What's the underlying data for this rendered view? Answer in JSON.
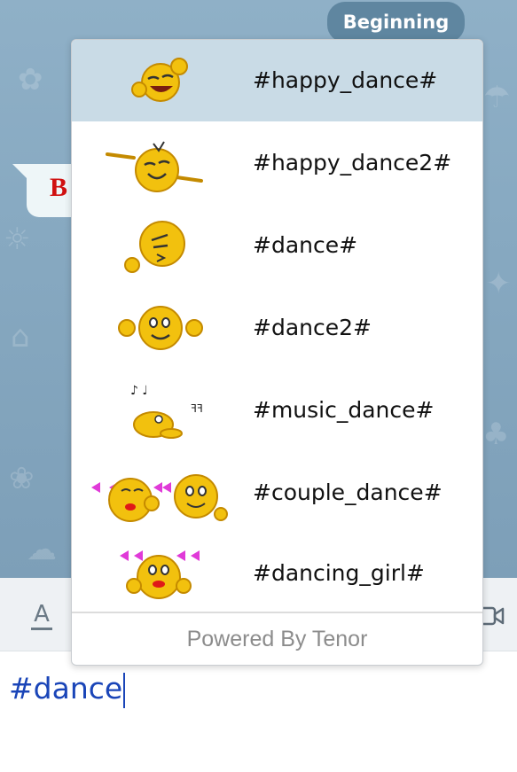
{
  "chat": {
    "date_pill": "Beginning",
    "message_fragment": "B"
  },
  "toolbar": {
    "format_icon": "text-format-icon",
    "video_icon": "video-camera-icon"
  },
  "input": {
    "value": "#dance"
  },
  "suggestions": {
    "selected_index": 0,
    "items": [
      {
        "label": "#happy_dance#",
        "icon": "happy-dance-emoticon"
      },
      {
        "label": "#happy_dance2#",
        "icon": "happy-dance2-emoticon"
      },
      {
        "label": "#dance#",
        "icon": "dance-emoticon"
      },
      {
        "label": "#dance2#",
        "icon": "dance2-emoticon"
      },
      {
        "label": "#music_dance#",
        "icon": "music-dance-emoticon"
      },
      {
        "label": "#couple_dance#",
        "icon": "couple-dance-emoticon"
      },
      {
        "label": "#dancing_girl#",
        "icon": "dancing-girl-emoticon"
      }
    ],
    "footer": "Powered By Tenor"
  },
  "colors": {
    "chat_background": "#87a9c1",
    "selected_row": "#c9dbe6",
    "input_text": "#1a45b8",
    "message_text": "#d01010",
    "date_pill": "#5f86a0"
  }
}
